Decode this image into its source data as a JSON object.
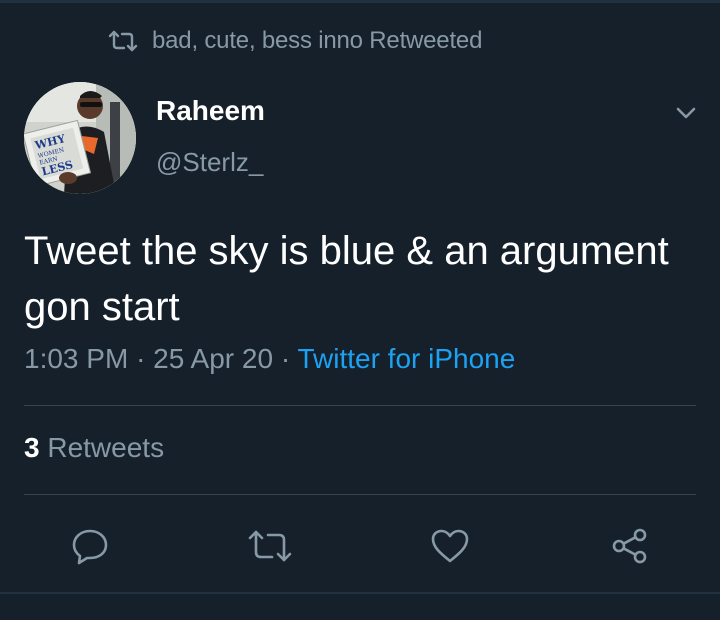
{
  "retweet_banner": {
    "text": "bad, cute, bess inno Retweeted",
    "icon": "retweet-icon"
  },
  "author": {
    "name": "Raheem",
    "handle": "@Sterlz_",
    "avatar_book_lines": [
      "WHY",
      "WOMEN",
      "EARN",
      "LESS"
    ]
  },
  "tweet": {
    "text": "Tweet the sky is blue & an argument gon start",
    "time": "1:03 PM",
    "date": "25 Apr 20",
    "separator": "·",
    "source": "Twitter for iPhone"
  },
  "stats": {
    "retweet_count": "3",
    "retweet_label": "Retweets"
  },
  "actions": [
    {
      "name": "reply-button",
      "icon": "reply-icon"
    },
    {
      "name": "retweet-button",
      "icon": "retweet-icon"
    },
    {
      "name": "like-button",
      "icon": "heart-icon"
    },
    {
      "name": "share-button",
      "icon": "share-icon"
    }
  ],
  "colors": {
    "background": "#15202b",
    "primary_text": "#ffffff",
    "secondary_text": "#8899a6",
    "accent": "#1da1f2",
    "divider": "#38444d"
  }
}
